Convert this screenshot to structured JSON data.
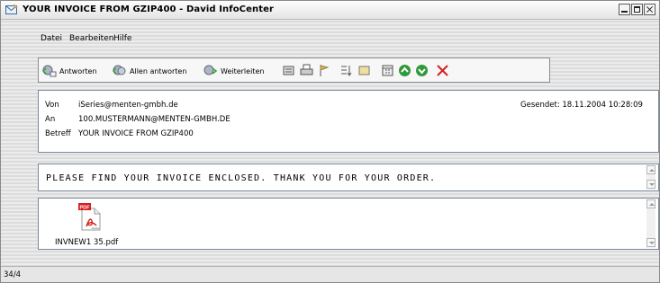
{
  "window": {
    "title": "YOUR INVOICE FROM GZIP400 - David InfoCenter"
  },
  "menu": {
    "items": [
      {
        "label": "Datei"
      },
      {
        "label": "Bearbeiten"
      },
      {
        "label": "Hilfe"
      }
    ]
  },
  "toolbar": {
    "reply_label": "Antworten",
    "reply_all_label": "Allen antworten",
    "forward_label": "Weiterleiten"
  },
  "header": {
    "from_label": "Von",
    "from_value": "iSeries@menten-gmbh.de",
    "to_label": "An",
    "to_value": "100.MUSTERMANN@MENTEN-GMBH.DE",
    "subject_label": "Betreff",
    "subject_value": "YOUR INVOICE FROM GZIP400",
    "sent": "Gesendet:  18.11.2004 10:28:09"
  },
  "body": {
    "text": "PLEASE FIND YOUR INVOICE ENCLOSED. THANK YOU FOR YOUR ORDER."
  },
  "attachment": {
    "filename": "INVNEW1 35.pdf",
    "icon_label": "PDF",
    "icon_sublabel": "Adobe"
  },
  "status": {
    "text": "34/4"
  },
  "colors": {
    "accent_red": "#d32020",
    "panel_border": "#7a8a99"
  }
}
